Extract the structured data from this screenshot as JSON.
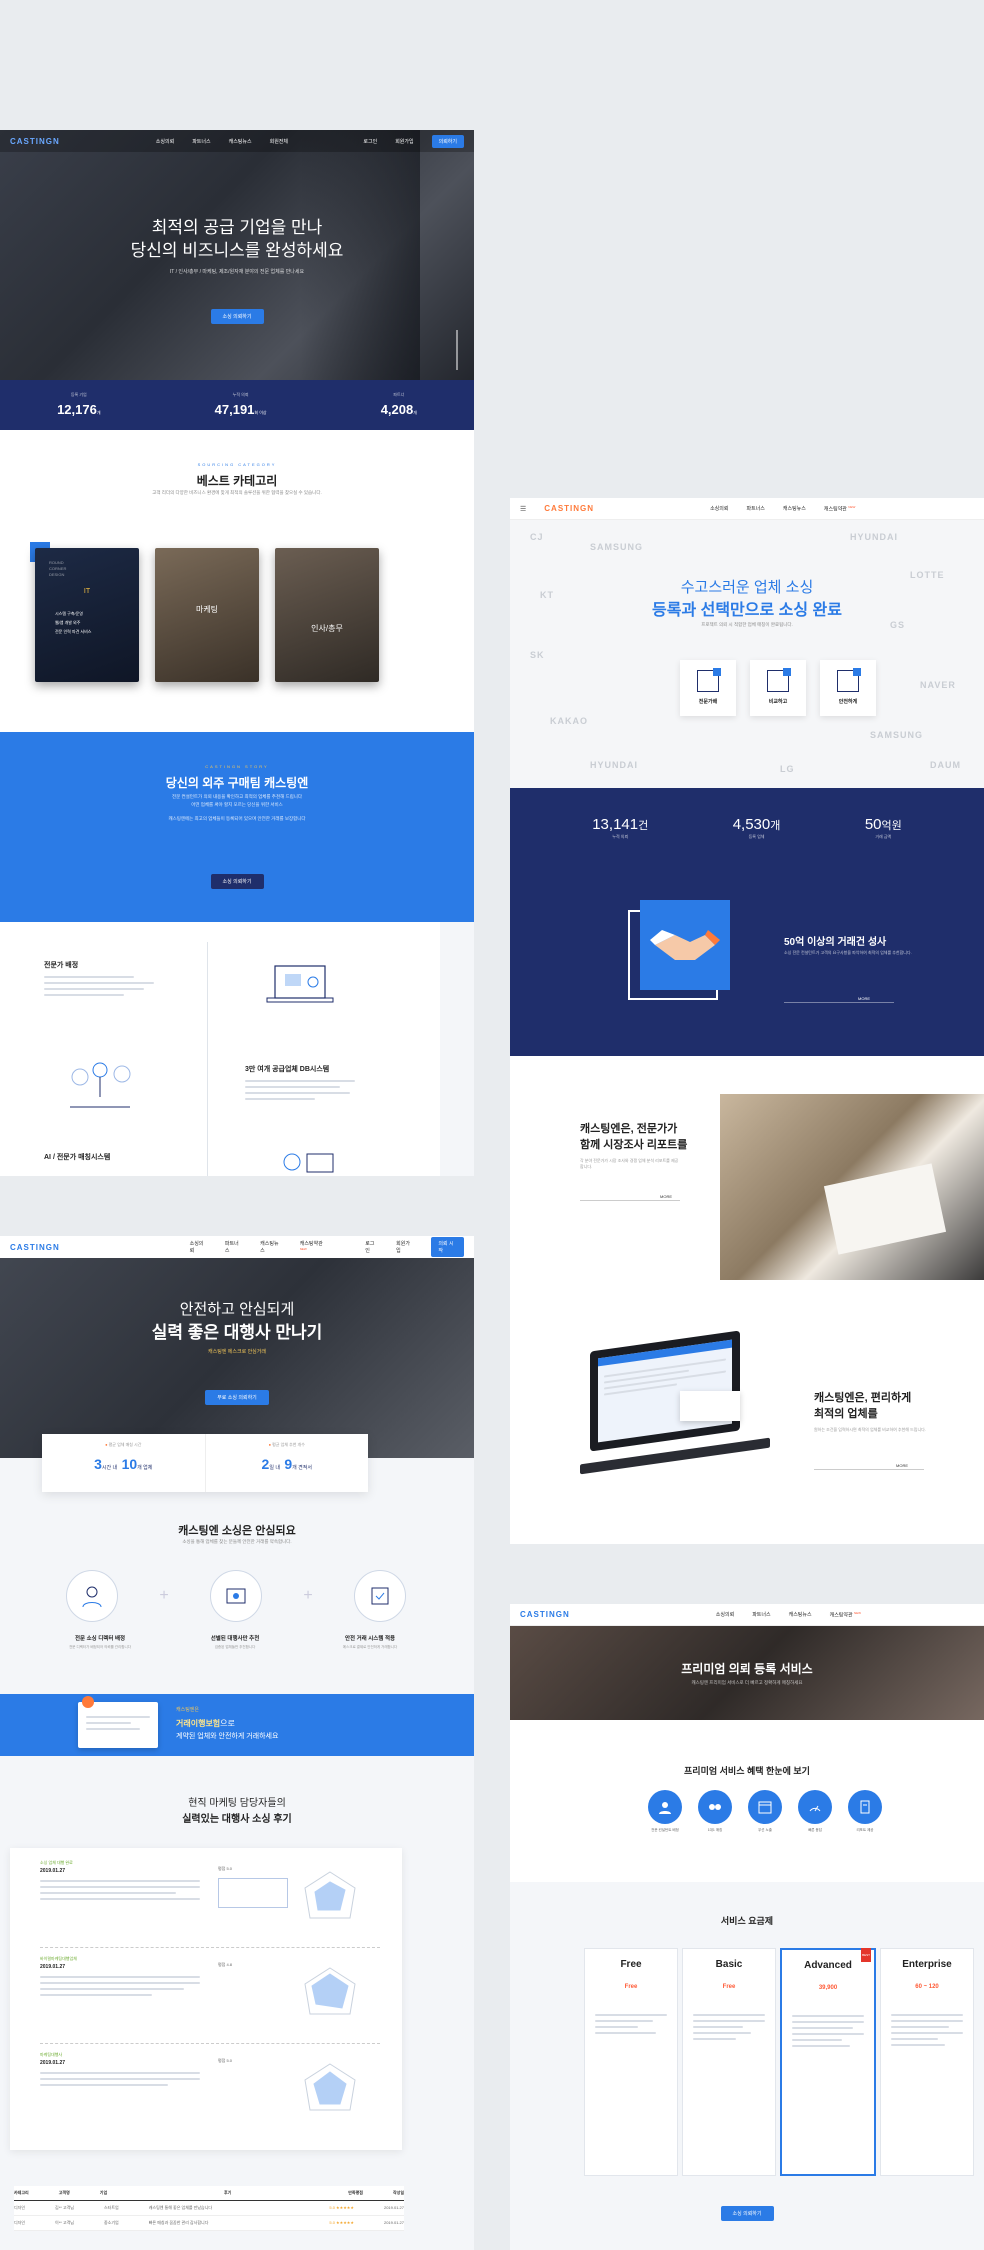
{
  "nav": {
    "logo": "CASTINGN",
    "items_a": [
      "소싱의뢰",
      "파트너스",
      "캐스팅뉴스",
      "회원전체",
      "로그인",
      "회원가입",
      "의뢰하기"
    ],
    "items_b": [
      "소싱의뢰",
      "파트너스",
      "캐스팅뉴스",
      "캐스팅약관",
      "로그인",
      "회원가입",
      "의뢰 시작"
    ],
    "items_c": [
      "소싱의뢰",
      "파트너스",
      "캐스팅뉴스",
      "캐스팅약관"
    ],
    "new_badge": "NEW"
  },
  "screen1": {
    "hero_line1_pre": "최적의 ",
    "hero_line1_bold": "공급 기업",
    "hero_line1_post": "을 만나",
    "hero_line2": "당신의 비즈니스를 완성하세요",
    "hero_sub": "IT / 인사/총무 / 마케팅, 제조/원자재 분야의 전문 업체를 만나세요",
    "hero_btn": "소싱 의뢰하기",
    "stats": [
      {
        "label": "등록 기업",
        "value": "12,176",
        "unit": "개"
      },
      {
        "label": "누적 의뢰",
        "value": "47,191",
        "unit": "회 이상"
      },
      {
        "label": "파트너",
        "value": "4,208",
        "unit": "개"
      }
    ],
    "cat_eyebrow": "SOURCING CATEGORY",
    "cat_title": "베스트 카테고리",
    "cat_sub": "고객 리더의 다양한 비즈니스 환경에 맞게 최적의 솔루션을 위한 협력을 찾으실 수 있습니다.",
    "cards": [
      {
        "title": "IT",
        "items": [
          "시스템 구축/운영",
          "웹/앱 개발 외주",
          "전문 인력 파견 서비스"
        ]
      },
      {
        "title": "마케팅"
      },
      {
        "title": "인사/총무"
      }
    ],
    "blue_eyebrow": "CASTINGN STORY",
    "blue_title": "당신의 외주 구매팀 캐스팅엔",
    "blue_desc1": "전문 컨설턴트가 의뢰 내용을 확인하고 최적의 업체를 추천해 드립니다",
    "blue_desc2": "어떤 업체를 써야 할지 모르는 당신을 위한 서비스",
    "blue_desc3": "캐스팅엔에는 최고의 업체들이 등록되어 있으며 안전한 거래를 보장합니다",
    "blue_btn": "소싱 의뢰하기",
    "feat1_title": "전문가 배정",
    "feat1_desc": "전문 컨설턴트가 의뢰 내용을 분석합니다",
    "feat2_title": "3만 여개 공급업체 DB시스템",
    "feat2_desc": "검증된 공급업체 데이터베이스를 보유하고 있습니다",
    "feat3_title": "AI / 전문가 매칭시스템"
  },
  "screen2": {
    "hero_line1": "수고스러운 업체 소싱",
    "hero_line2": "등록과 선택만으로 소싱 완료",
    "hero_sub": "프로젝트 의뢰 시 적합한 업체 매칭이 완료됩니다.",
    "steps": [
      "전문가배",
      "비교하고",
      "안전하게"
    ],
    "logos": [
      "CJ",
      "SAMSUNG",
      "HYUNDAI",
      "LOTTE",
      "KT",
      "GS",
      "SK",
      "NAVER",
      "KAKAO",
      "SAMSUNG",
      "HYUNDAI",
      "LG",
      "DAUM"
    ],
    "stats": [
      {
        "value": "13,141",
        "unit": "건",
        "label": "누적 의뢰"
      },
      {
        "value": "4,530",
        "unit": "개",
        "label": "등록 업체"
      },
      {
        "value": "50",
        "unit": "억원",
        "label": "거래 금액"
      }
    ],
    "deal_title": "50억 이상의 거래건 성사",
    "deal_desc": "소싱 전문 컨설턴트가 고객의 요구사항을 파악하여 최적의 업체를 추천합니다.",
    "deal_more": "MORE",
    "report_title_1": "캐스팅엔은, 전문가가",
    "report_title_2": "함께 시장조사 리포트를",
    "report_desc": "각 분야 전문가가 시장 조사와 경쟁 업체 분석 리포트를 제공합니다.",
    "report_more": "MORE",
    "pick_title_1": "캐스팅엔은, 편리하게",
    "pick_title_2": "최적의 업체를",
    "pick_desc": "원하는 조건을 입력하시면 최적의 업체를 비교하여 추천해 드립니다.",
    "pick_more": "MORE"
  },
  "screen3": {
    "hero_line1": "안전하고 안심되게",
    "hero_line2": "실력 좋은 대행사 만나기",
    "hero_sub": "캐스팅엔 에스크로 안심거래",
    "hero_btn": "무료 소싱 의뢰하기",
    "time_label_1": "평균 업체 매칭 시간",
    "time_label_2": "평균 업체 추천 개수",
    "time1_a": "3",
    "time1_a_u": "시간 내",
    "time1_b": "10",
    "time1_b_u": "개 업체",
    "time2_a": "2",
    "time2_a_u": "일 내",
    "time2_b": "9",
    "time2_b_u": "개 견적서",
    "safe_title": "캐스팅엔 소싱은 안심되요",
    "safe_sub": "소싱을 통해 업체를 찾는 분들께 안전한 거래를 약속합니다.",
    "safe_items": [
      {
        "title": "전문 소싱 디렉터 배정",
        "desc": "전문 디렉터가 배정되어 의뢰를 관리합니다"
      },
      {
        "title": "선별된 대행사만 추천",
        "desc": "검증된 업체들만 추천합니다"
      },
      {
        "title": "안전 거래 시스템 적용",
        "desc": "에스크로 결제로 안전하게 거래합니다"
      }
    ],
    "banner_label": "캐스팅엔은",
    "banner_title_bold": "거래이행보험",
    "banner_title_rest": "으로",
    "banner_sub": "계약된 업체와 안전하게 거래하세요",
    "review_title_1": "현직 마케팅 담당자들의",
    "review_title_2": "실력있는 대행사 소싱 후기",
    "reviews": [
      {
        "tag": "소싱 업체 대행 완료",
        "date": "2019.01.27",
        "score": "평점 5.0"
      },
      {
        "tag": "바이럴마케팅대행업체",
        "date": "2019.01.27",
        "score": "평점 4.8"
      },
      {
        "tag": "마케팅대행사",
        "date": "2019.01.27",
        "score": "평점 5.0"
      }
    ],
    "table_head": [
      "카테고리",
      "고객명",
      "기업",
      "후기",
      "만족평점",
      "작성일"
    ],
    "table_rows": [
      [
        "디자인",
        "김** 고객님",
        "스타트업",
        "캐스팅엔 통해 좋은 업체를 만났습니다",
        "5.0 ★★★★★",
        "2019.01.27"
      ],
      [
        "디자인",
        "이** 고객님",
        "중소기업",
        "빠른 매칭과 꼼꼼한 관리 감사합니다",
        "5.0 ★★★★★",
        "2019.01.27"
      ]
    ]
  },
  "screen4": {
    "hero_title": "프리미엄 의뢰 등록 서비스",
    "hero_sub": "캐스팅엔 프리미엄 서비스로 더 빠르고 정확하게 매칭하세요",
    "benefit_title": "프리미엄 서비스 혜택 한눈에 보기",
    "benefits": [
      "전문 컨설턴트 배정",
      "1대1 매칭",
      "우선 노출",
      "빠른 응답",
      "리포트 제공"
    ],
    "price_title": "서비스 요금제",
    "plans": [
      {
        "name": "Free",
        "price": "Free",
        "tag": ""
      },
      {
        "name": "Basic",
        "price": "Free",
        "tag": ""
      },
      {
        "name": "Advanced",
        "price": "39,900",
        "tag": "BEST"
      },
      {
        "name": "Enterprise",
        "price": "60 ~ 120",
        "tag": ""
      }
    ],
    "price_btn": "소싱 의뢰하기"
  }
}
